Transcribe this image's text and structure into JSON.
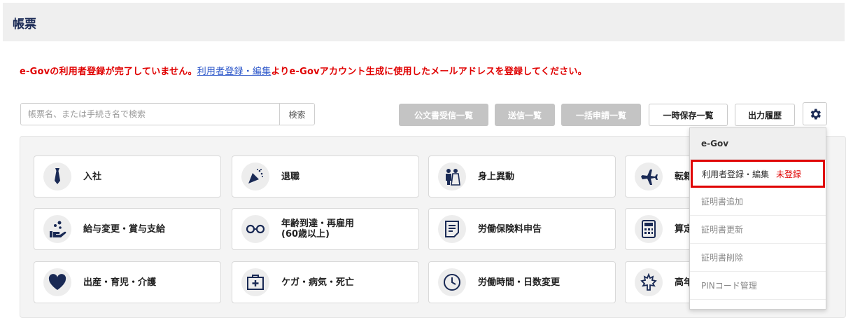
{
  "header": {
    "title": "帳票"
  },
  "warning": {
    "before": "e-Govの利用者登録が完了していません。",
    "link": "利用者登録・編集",
    "after": "よりe-Govアカウント生成に使用したメールアドレスを登録してください。"
  },
  "search": {
    "placeholder": "帳票名、または手続き名で検索",
    "value": "",
    "button": "検索"
  },
  "toolbar": {
    "received_docs": "公文書受信一覧",
    "sent_list": "送信一覧",
    "bulk_list": "一括申請一覧",
    "temp_saved": "一時保存一覧",
    "output_history": "出力履歴"
  },
  "cards": [
    {
      "label": "入社",
      "icon": "necktie-icon"
    },
    {
      "label": "退職",
      "icon": "party-popper-icon"
    },
    {
      "label": "身上異動",
      "icon": "wedding-couple-icon"
    },
    {
      "label": "転籍",
      "icon": "airplane-icon"
    },
    {
      "label": "給与変更・賞与支給",
      "icon": "hand-coins-icon"
    },
    {
      "label": "年齢到達・再雇用\n(60歳以上)",
      "icon": "glasses-icon"
    },
    {
      "label": "労働保険料申告",
      "icon": "document-icon"
    },
    {
      "label": "算定",
      "icon": "calculator-icon"
    },
    {
      "label": "出産・育児・介護",
      "icon": "heart-icon"
    },
    {
      "label": "ケガ・病気・死亡",
      "icon": "first-aid-icon"
    },
    {
      "label": "労働時間・日数変更",
      "icon": "clock-icon"
    },
    {
      "label": "高年",
      "icon": "maple-leaf-icon"
    }
  ],
  "dropdown": {
    "header": "e-Gov",
    "items": [
      {
        "label": "利用者登録・編集",
        "badge": "未登録"
      },
      {
        "label": "証明書追加"
      },
      {
        "label": "証明書更新"
      },
      {
        "label": "証明書削除"
      },
      {
        "label": "PINコード管理"
      }
    ]
  },
  "colors": {
    "accent_red": "#e00000",
    "link_blue": "#2a55c9",
    "icon_navy": "#1a2a55"
  }
}
